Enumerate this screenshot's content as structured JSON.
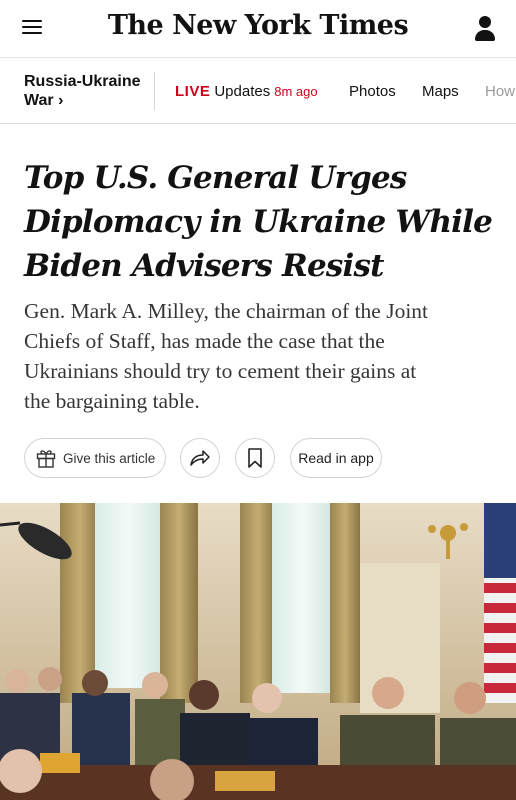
{
  "header": {
    "logo_text": "The New York Times",
    "menu_icon": "hamburger-menu-icon",
    "account_icon": "account-icon"
  },
  "section_nav": {
    "section_title_line1": "Russia-Ukraine",
    "section_title_line2": "War ›",
    "live_tag": "LIVE",
    "live_label": "Updates",
    "live_age": "8m ago",
    "links": [
      "Photos",
      "Maps",
      "How"
    ]
  },
  "article": {
    "headline_line1": "Top U.S. General Urges",
    "headline_line2": "Diplomacy in Ukraine While",
    "headline_line3": "Biden Advisers Resist",
    "summary_line1": "Gen. Mark A. Milley, the chairman of the Joint",
    "summary_line2": "Chiefs of Staff, has made the case that the",
    "summary_line3": "Ukrainians should try to cement their gains at",
    "summary_line4": "the bargaining table."
  },
  "actions": {
    "gift_label": "Give this article",
    "gift_icon": "gift-icon",
    "share_icon": "share-arrow-icon",
    "save_icon": "bookmark-icon",
    "read_app_label": "Read in app"
  },
  "colors": {
    "live_red": "#d0021b",
    "text": "#121212",
    "border": "#d4d4d4"
  }
}
